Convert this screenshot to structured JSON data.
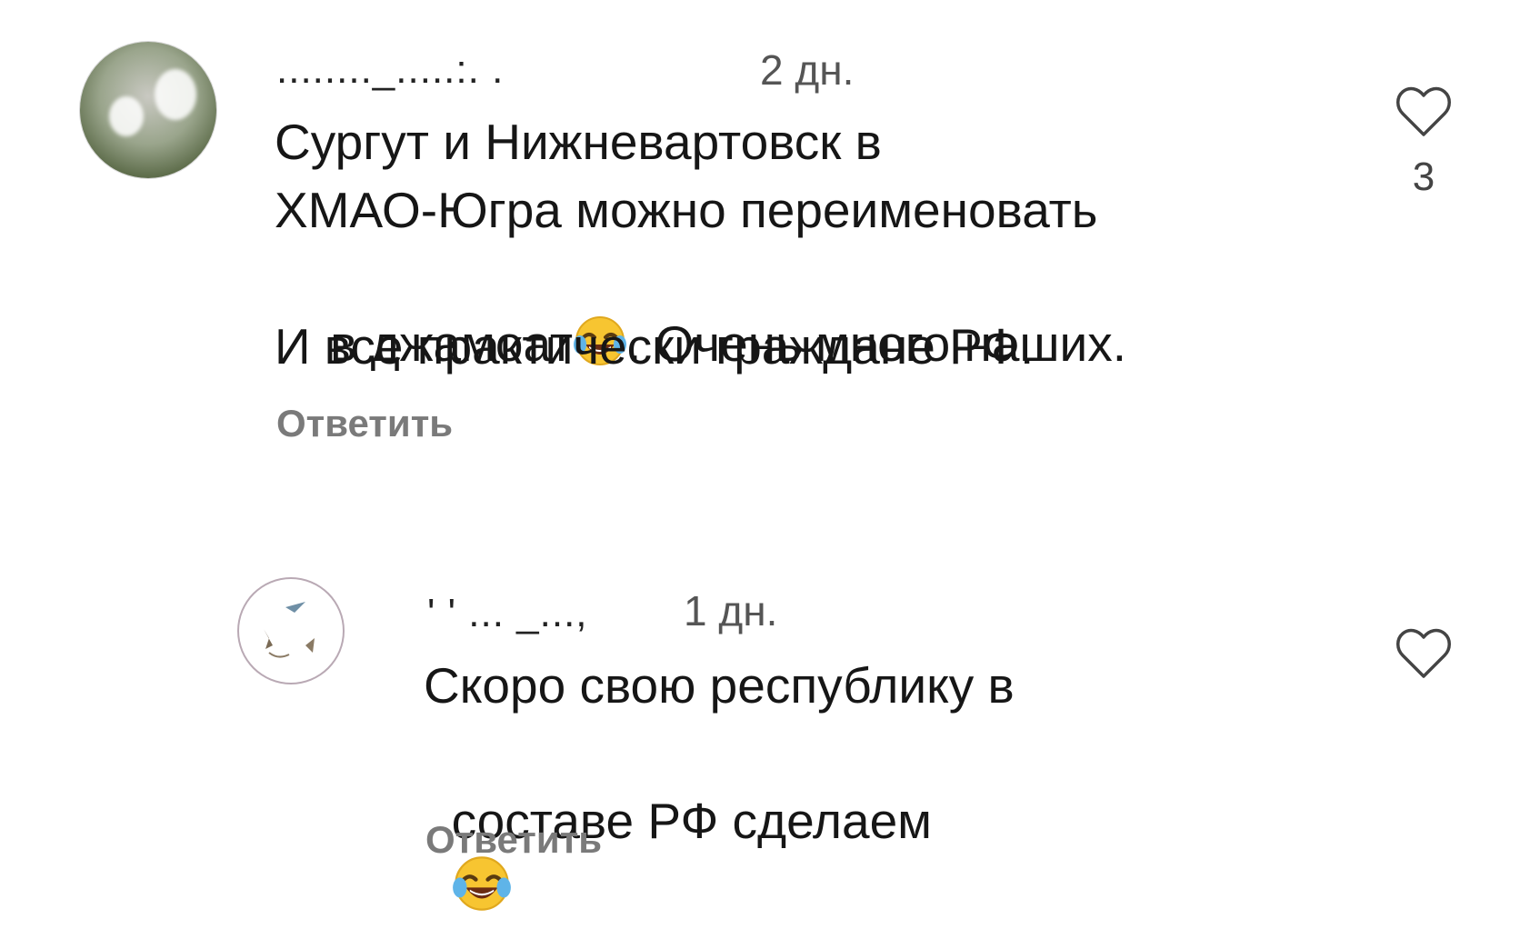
{
  "comments": [
    {
      "username": "........_.....:. .",
      "time": "2 дн.",
      "lines": [
        "Сургут и Нижневартовск в",
        "ХМАО-Югра можно переименовать",
        "в джамоат",
        ". Очень много наших.",
        "И все практически граждане РФ."
      ],
      "emoji": "face-with-tears-of-joy",
      "reply_label": "Ответить",
      "like_count": "3"
    },
    {
      "username": "' ' ... _..., ",
      "time": "1 дн.",
      "lines": [
        "Скоро свою республику в",
        "составе РФ сделаем"
      ],
      "emoji": "face-with-tears-of-joy",
      "reply_label": "Ответить"
    }
  ],
  "colors": {
    "text": "#161616",
    "muted": "#7a7a7a",
    "time": "#555555",
    "background": "#ffffff"
  }
}
